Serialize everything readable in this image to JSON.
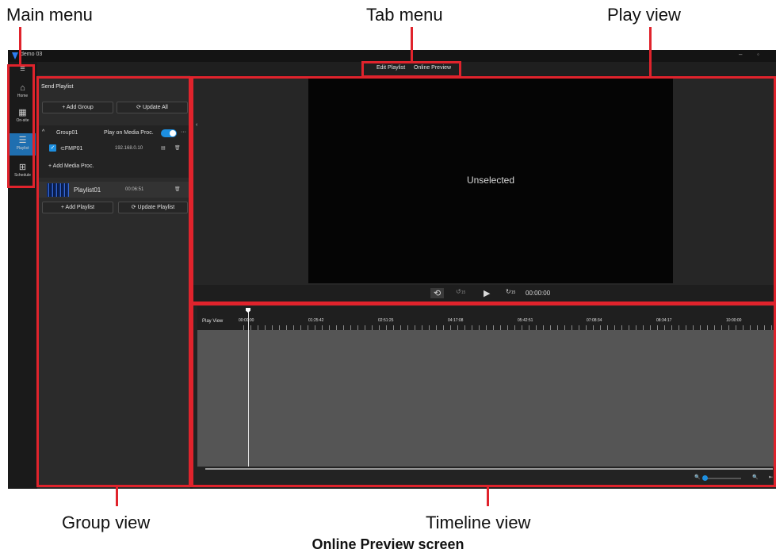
{
  "callouts": {
    "main_menu": "Main menu",
    "tab_menu": "Tab menu",
    "play_view": "Play view",
    "group_view": "Group view",
    "timeline_view": "Timeline view",
    "caption": "Online Preview screen"
  },
  "app": {
    "title": "demo 03",
    "window_buttons": {
      "minimize": "–",
      "restore": "◦"
    }
  },
  "tabs": [
    {
      "label": "Edit Playlist"
    },
    {
      "label": "Online Preview"
    }
  ],
  "rail": {
    "menu_icon": "hamburger-icon",
    "items": [
      {
        "label": "Home",
        "icon": "home-icon"
      },
      {
        "label": "On-site",
        "icon": "building-icon"
      },
      {
        "label": "Playlist",
        "icon": "playlist-icon",
        "active": true
      },
      {
        "label": "Schedule",
        "icon": "calendar-icon"
      }
    ]
  },
  "group_view": {
    "title": "Send Playlist",
    "add_group": "+ Add Group",
    "update_all": "Update All",
    "group": {
      "name": "Group01",
      "play_on_label": "Play on Media Proc.",
      "more": "···",
      "device": {
        "name": "FMP01",
        "ip": "192.168.0.10"
      },
      "add_media_proc": "+ Add Media Proc."
    },
    "playlist": {
      "name": "Playlist01",
      "duration": "00:06:51"
    },
    "add_playlist": "+ Add Playlist",
    "update_playlist": "Update Playlist"
  },
  "play_view": {
    "status": "Unselected",
    "time": "00:00:00",
    "rewind_label": "15",
    "forward_label": "15"
  },
  "timeline": {
    "track_label": "Play View",
    "ticks": [
      "00:00:00",
      "01:25:42",
      "02:51:25",
      "04:17:08",
      "05:42:51",
      "07:08:34",
      "08:34:17",
      "10:00:00"
    ]
  },
  "colors": {
    "accent": "#1d8fe0",
    "highlight": "#e0232c"
  }
}
